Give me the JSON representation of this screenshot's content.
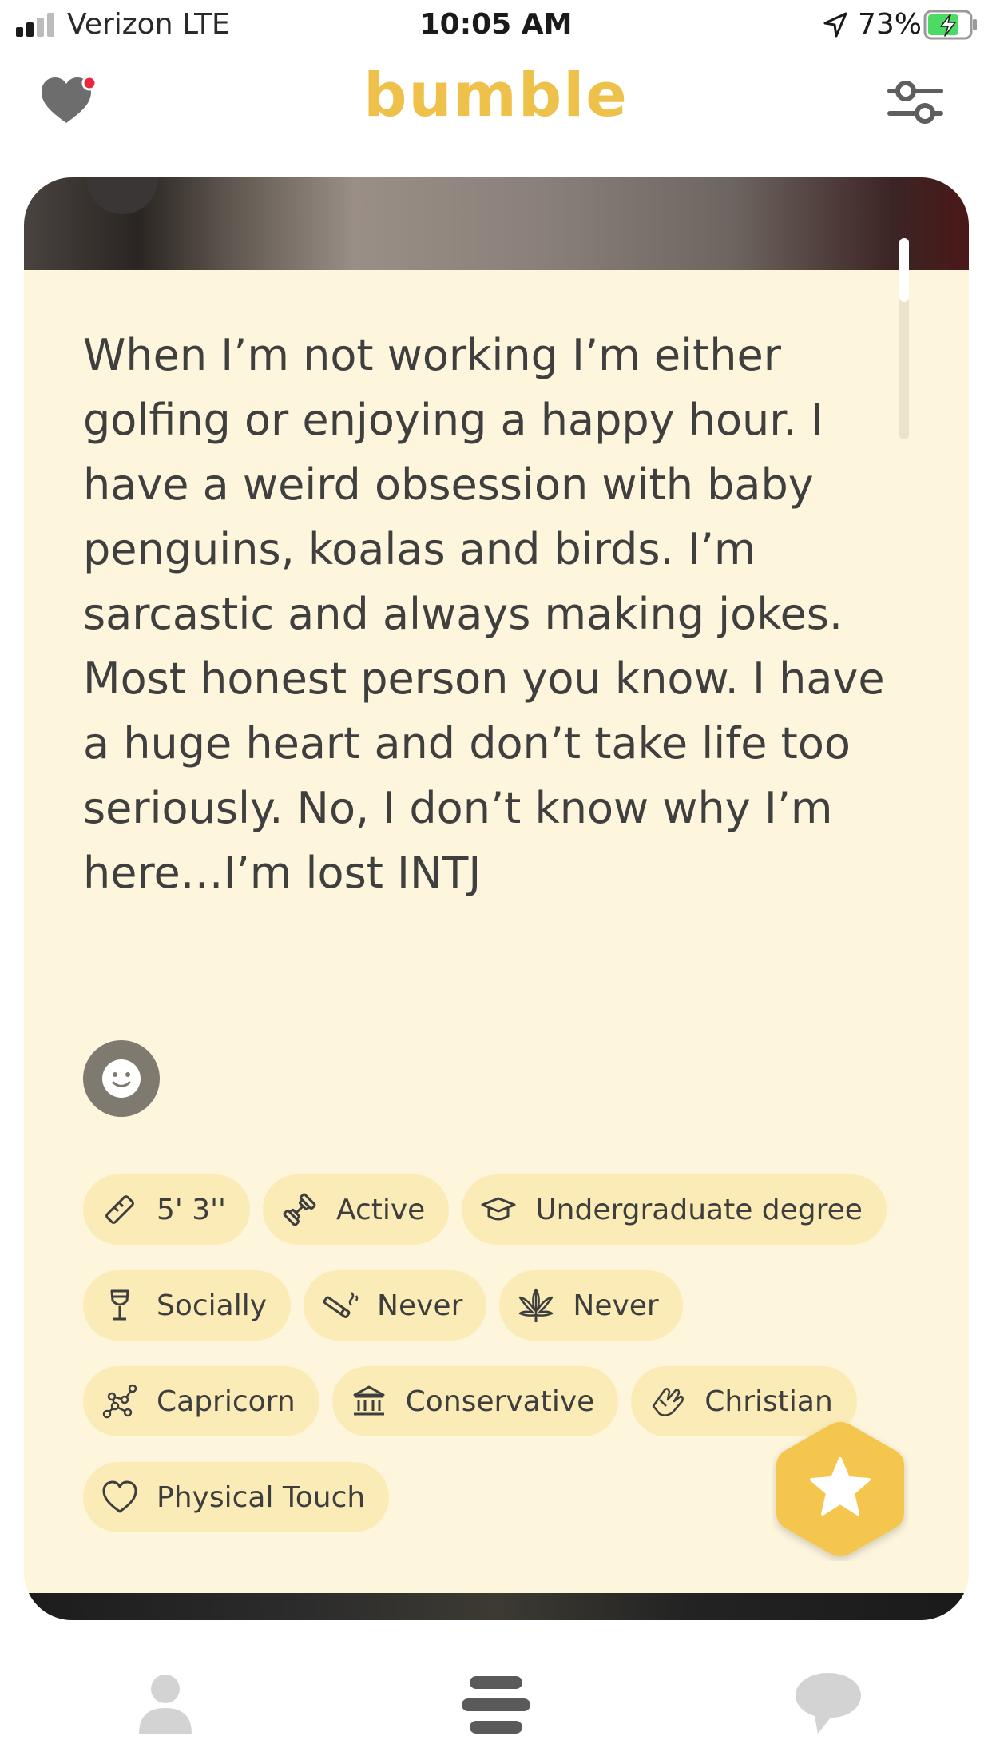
{
  "status_bar": {
    "carrier": "Verizon  LTE",
    "time": "10:05 AM",
    "battery_percent": "73%",
    "signal_bars": 2,
    "signal_bars_total": 4
  },
  "header": {
    "logo": "bumble",
    "icons": [
      "heart-notification-icon",
      "filters-icon"
    ],
    "notification_dot_color": "#e8283c",
    "brand_color": "#eec24a"
  },
  "profile": {
    "bio": "When I’m not working I’m either golfing or enjoying a happy hour. I have a weird obsession with baby penguins, koalas and birds. I’m sarcastic and always making jokes. Most honest person you know. I have a huge heart and don’t take life too seriously. No, I don’t know why I’m here…I’m lost INTJ",
    "badges": [
      {
        "label": "5' 3''",
        "icon": "ruler-icon"
      },
      {
        "label": "Active",
        "icon": "dumbbell-icon"
      },
      {
        "label": "Undergraduate degree",
        "icon": "graduation-cap-icon"
      },
      {
        "label": "Socially",
        "icon": "wine-glass-icon"
      },
      {
        "label": "Never",
        "icon": "cigarette-icon"
      },
      {
        "label": "Never",
        "icon": "cannabis-leaf-icon"
      },
      {
        "label": "Capricorn",
        "icon": "zodiac-constellation-icon"
      },
      {
        "label": "Conservative",
        "icon": "government-building-icon"
      },
      {
        "label": "Christian",
        "icon": "praying-hands-icon"
      },
      {
        "label": "Physical Touch",
        "icon": "heart-outline-icon"
      }
    ]
  },
  "actions": {
    "superswipe_icon": "star-icon"
  },
  "bottom_nav": {
    "items": [
      "profile-icon",
      "discover-stack-icon",
      "chat-icon"
    ],
    "active": "discover-stack-icon"
  }
}
